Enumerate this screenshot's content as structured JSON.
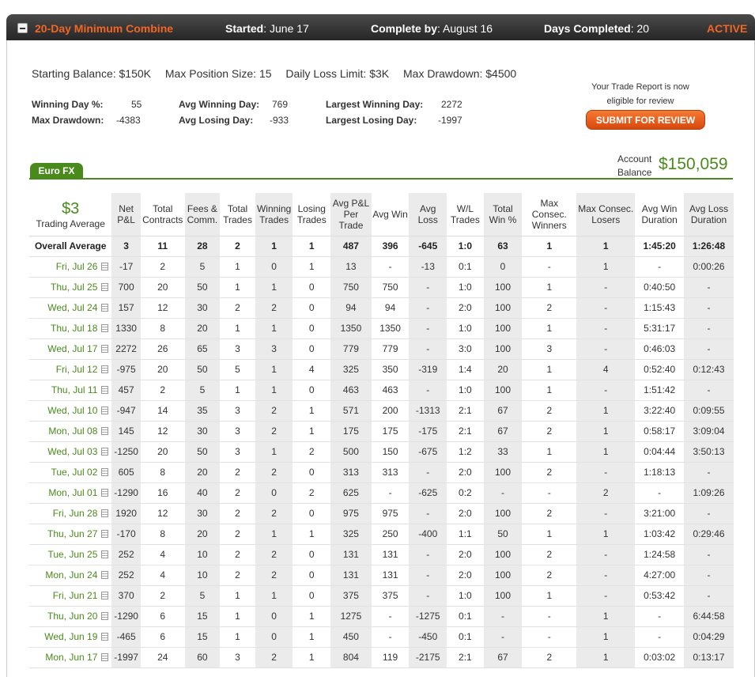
{
  "header": {
    "title": "20-Day Minimum Combine",
    "started_label": "Started",
    "started_value": ": June 17",
    "complete_label": "Complete by",
    "complete_value": ": August 16",
    "days_label": "Days Completed",
    "days_value": ": 20",
    "status": "ACTIVE"
  },
  "limits": {
    "starting_balance": "Starting Balance: $150K",
    "max_position": "Max Position Size: 15",
    "daily_loss": "Daily Loss Limit: $3K",
    "max_drawdown": "Max Drawdown: $4500"
  },
  "stats": {
    "winning_day_label": "Winning Day %:",
    "winning_day_value": "55",
    "max_drawdown_label": "Max Drawdown:",
    "max_drawdown_value": "-4383",
    "avg_winning_label": "Avg Winning Day:",
    "avg_winning_value": "769",
    "avg_losing_label": "Avg Losing Day:",
    "avg_losing_value": "-933",
    "largest_winning_label": "Largest Winning Day:",
    "largest_winning_value": "2272",
    "largest_losing_label": "Largest Losing Day:",
    "largest_losing_value": "-1997"
  },
  "review": {
    "note_line1": "Your Trade Report is now",
    "note_line2": "eligible for review",
    "button": "SUBMIT FOR REVIEW"
  },
  "account": {
    "label_line1": "Account",
    "label_line2": "Balance",
    "value": "$150,059"
  },
  "tab": {
    "label": "Euro FX"
  },
  "table": {
    "trading_average_value": "$3",
    "trading_average_label": "Trading Average",
    "columns": [
      "Net P&L",
      "Total Contracts",
      "Fees & Comm.",
      "Total Trades",
      "Winning Trades",
      "Losing Trades",
      "Avg P&L Per Trade",
      "Avg Win",
      "Avg Loss",
      "W/L Trades",
      "Total Win %",
      "Max Consec. Winners",
      "Max Consec. Losers",
      "Avg Win Duration",
      "Avg Loss Duration"
    ],
    "overall": [
      "Overall Average",
      "3",
      "11",
      "28",
      "2",
      "1",
      "1",
      "487",
      "396",
      "-645",
      "1:0",
      "63",
      "1",
      "1",
      "1:45:20",
      "1:26:48"
    ],
    "rows": [
      [
        "Fri, Jul 26",
        "-17",
        "2",
        "5",
        "1",
        "0",
        "1",
        "13",
        "-",
        "-13",
        "0:1",
        "0",
        "-",
        "1",
        "-",
        "0:00:26"
      ],
      [
        "Thu, Jul 25",
        "700",
        "20",
        "50",
        "1",
        "1",
        "0",
        "750",
        "750",
        "-",
        "1:0",
        "100",
        "1",
        "-",
        "0:40:50",
        "-"
      ],
      [
        "Wed, Jul 24",
        "157",
        "12",
        "30",
        "2",
        "2",
        "0",
        "94",
        "94",
        "-",
        "2:0",
        "100",
        "2",
        "-",
        "1:15:43",
        "-"
      ],
      [
        "Thu, Jul 18",
        "1330",
        "8",
        "20",
        "1",
        "1",
        "0",
        "1350",
        "1350",
        "-",
        "1:0",
        "100",
        "1",
        "-",
        "5:31:17",
        "-"
      ],
      [
        "Wed, Jul 17",
        "2272",
        "26",
        "65",
        "3",
        "3",
        "0",
        "779",
        "779",
        "-",
        "3:0",
        "100",
        "3",
        "-",
        "0:46:03",
        "-"
      ],
      [
        "Fri, Jul 12",
        "-975",
        "20",
        "50",
        "5",
        "1",
        "4",
        "325",
        "350",
        "-319",
        "1:4",
        "20",
        "1",
        "4",
        "0:52:40",
        "0:12:43"
      ],
      [
        "Thu, Jul 11",
        "457",
        "2",
        "5",
        "1",
        "1",
        "0",
        "463",
        "463",
        "-",
        "1:0",
        "100",
        "1",
        "-",
        "1:51:42",
        "-"
      ],
      [
        "Wed, Jul 10",
        "-947",
        "14",
        "35",
        "3",
        "2",
        "1",
        "571",
        "200",
        "-1313",
        "2:1",
        "67",
        "2",
        "1",
        "3:22:40",
        "0:09:55"
      ],
      [
        "Mon, Jul 08",
        "145",
        "12",
        "30",
        "3",
        "2",
        "1",
        "175",
        "175",
        "-175",
        "2:1",
        "67",
        "2",
        "1",
        "0:58:17",
        "3:09:04"
      ],
      [
        "Wed, Jul 03",
        "-1250",
        "20",
        "50",
        "3",
        "1",
        "2",
        "500",
        "150",
        "-675",
        "1:2",
        "33",
        "1",
        "1",
        "0:04:44",
        "3:50:13"
      ],
      [
        "Tue, Jul 02",
        "605",
        "8",
        "20",
        "2",
        "2",
        "0",
        "313",
        "313",
        "-",
        "2:0",
        "100",
        "2",
        "-",
        "1:18:13",
        "-"
      ],
      [
        "Mon, Jul 01",
        "-1290",
        "16",
        "40",
        "2",
        "0",
        "2",
        "625",
        "-",
        "-625",
        "0:2",
        "-",
        "-",
        "2",
        "-",
        "1:09:26"
      ],
      [
        "Fri, Jun 28",
        "1920",
        "12",
        "30",
        "2",
        "2",
        "0",
        "975",
        "975",
        "-",
        "2:0",
        "100",
        "2",
        "-",
        "3:21:00",
        "-"
      ],
      [
        "Thu, Jun 27",
        "-170",
        "8",
        "20",
        "2",
        "1",
        "1",
        "325",
        "250",
        "-400",
        "1:1",
        "50",
        "1",
        "1",
        "1:03:42",
        "0:29:46"
      ],
      [
        "Tue, Jun 25",
        "252",
        "4",
        "10",
        "2",
        "2",
        "0",
        "131",
        "131",
        "-",
        "2:0",
        "100",
        "2",
        "-",
        "1:24:58",
        "-"
      ],
      [
        "Mon, Jun 24",
        "252",
        "4",
        "10",
        "2",
        "2",
        "0",
        "131",
        "131",
        "-",
        "2:0",
        "100",
        "2",
        "-",
        "4:27:00",
        "-"
      ],
      [
        "Fri, Jun 21",
        "370",
        "2",
        "5",
        "1",
        "1",
        "0",
        "375",
        "375",
        "-",
        "1:0",
        "100",
        "1",
        "-",
        "0:53:42",
        "-"
      ],
      [
        "Thu, Jun 20",
        "-1290",
        "6",
        "15",
        "1",
        "0",
        "1",
        "1275",
        "-",
        "-1275",
        "0:1",
        "-",
        "-",
        "1",
        "-",
        "6:44:58"
      ],
      [
        "Wed, Jun 19",
        "-465",
        "6",
        "15",
        "1",
        "0",
        "1",
        "450",
        "-",
        "-450",
        "0:1",
        "-",
        "-",
        "1",
        "-",
        "0:04:29"
      ],
      [
        "Mon, Jun 17",
        "-1997",
        "24",
        "60",
        "3",
        "2",
        "1",
        "804",
        "119",
        "-2175",
        "2:1",
        "67",
        "2",
        "1",
        "0:03:02",
        "0:13:17"
      ]
    ]
  }
}
